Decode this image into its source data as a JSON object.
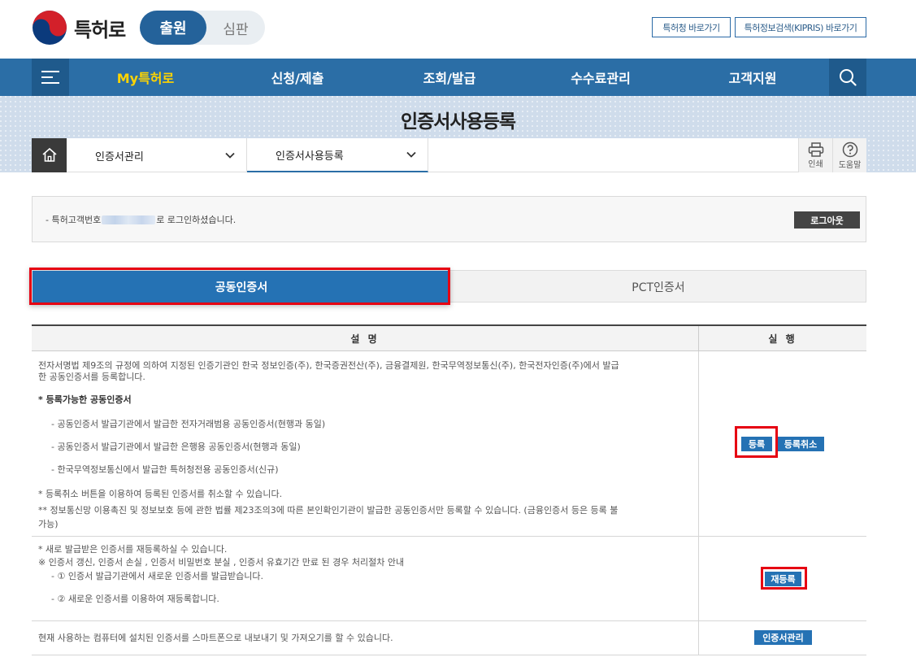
{
  "header": {
    "logo_text": "특허로",
    "mode_active": "출원",
    "mode_inactive": "심판",
    "link_kipo": "특허청 바로가기",
    "link_kipris": "특허정보검색(KIPRIS) 바로가기"
  },
  "gnb": {
    "items": [
      "My특허로",
      "신청/제출",
      "조회/발급",
      "수수료관리",
      "고객지원"
    ]
  },
  "page": {
    "title": "인증서사용등록"
  },
  "breadcrumb": {
    "level1": "인증서관리",
    "level2": "인증서사용등록",
    "print": "인쇄",
    "help": "도움말"
  },
  "login": {
    "prefix": "- 특허고객번호",
    "suffix": "로 로그인하셨습니다.",
    "logout": "로그아웃"
  },
  "tabs": {
    "active": "공동인증서",
    "inactive": "PCT인증서"
  },
  "table": {
    "headers": [
      "설 명",
      "실 행"
    ],
    "row1": {
      "intro_line1": "전자서명법 제9조의 규정에 의하여 지정된 인증기관인 한국 정보인증(주), 한국증권전산(주), 금융결제원, 한국무역정보통신(주), 한국전자인증(주)에서 발급",
      "intro_line2": "한 공동인증서를 등록합니다.",
      "subtitle": "* 등록가능한 공동인증서",
      "items": [
        "- 공동인증서 발급기관에서 발급한 전자거래범용 공동인증서(현행과 동일)",
        "- 공동인증서 발급기관에서 발급한 은행용 공동인증서(현행과 동일)",
        "- 한국무역정보통신에서 발급한 특허청전용 공동인증서(신규)"
      ],
      "note1": "* 등록취소 버튼을 이용하여 등록된 인증서를 취소할 수 있습니다.",
      "note2_line1": "** 정보통신망 이용촉진 및 정보보호 등에 관한 법률 제23조의3에 따른 본인확인기관이 발급한 공동인증서만 등록할 수 있습니다. (금융인증서 등은 등록 불",
      "note2_line2": "가능)",
      "btn_register": "등록",
      "btn_cancel": "등록취소"
    },
    "row2": {
      "line1": "* 새로 발급받은 인증서를 재등록하실 수 있습니다.",
      "line2": "※ 인증서 갱신, 인증서 손실 , 인증서 비밀번호 분실 , 인증서 유효기간 만료 된 경우 처리절차 안내",
      "step1": "- ① 인증서 발급기관에서 새로운 인증서를 발급받습니다.",
      "step2": "- ② 새로운 인증서를 이용하여 재등록합니다.",
      "btn_reregister": "재등록"
    },
    "row3": {
      "text": "현재 사용하는 컴퓨터에 설치된 인증서를 스마트폰으로 내보내기 및 가져오기를 할 수 있습니다.",
      "btn_manage": "인증서관리"
    }
  },
  "colors": {
    "primary": "#2b6ea6",
    "accent_yellow": "#ffd400",
    "tab_active": "#2572b4",
    "highlight_red": "#e60012"
  }
}
